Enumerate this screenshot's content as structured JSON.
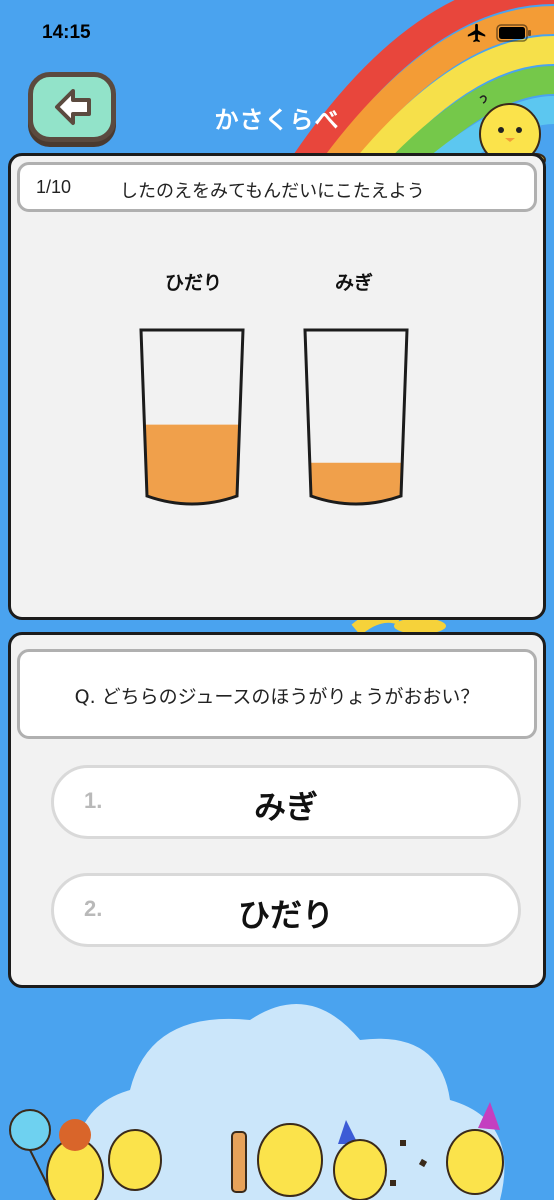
{
  "status_bar": {
    "time": "14:15"
  },
  "header": {
    "title": "かさくらべ"
  },
  "question": {
    "counter": "1/10",
    "instruction": "したのえをみてもんだいにこたえよう",
    "left_label": "ひだり",
    "right_label": "みぎ",
    "left_fill_level": 0.43,
    "right_fill_level": 0.2,
    "juice_color": "#f0a04b",
    "prompt": "Q. どちらのジュースのほうがりょうがおおい？"
  },
  "answers": [
    {
      "number": "1.",
      "label": "みぎ"
    },
    {
      "number": "2.",
      "label": "ひだり"
    }
  ],
  "colors": {
    "background": "#4aa3ef",
    "back_button": "#92e3c9",
    "panel": "#f2f2f2"
  }
}
